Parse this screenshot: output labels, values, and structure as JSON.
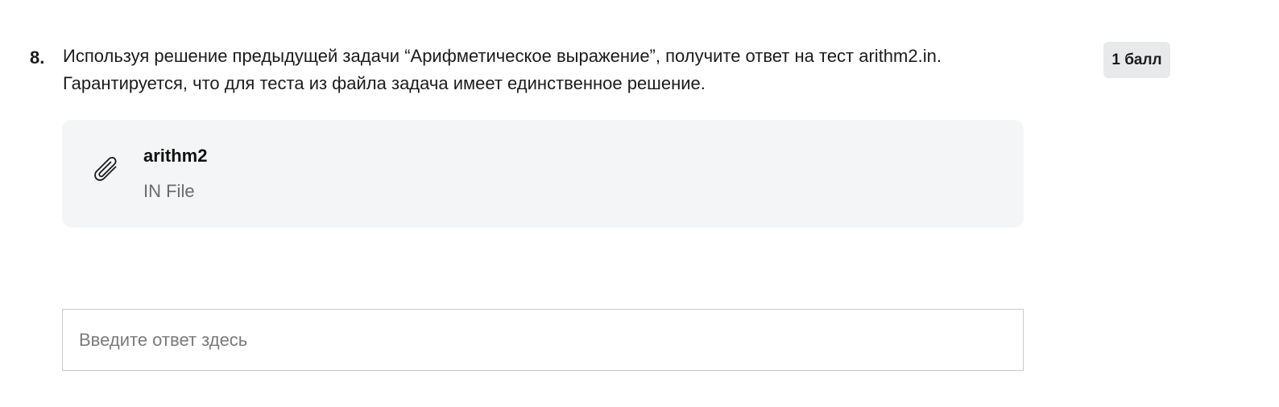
{
  "question": {
    "number": "8.",
    "text_line1": "Используя решение предыдущей задачи “Арифметическое выражение”, получите ответ на тест arithm2.in.",
    "text_line2": "Гарантируется, что для теста из файла задача имеет единственное решение.",
    "points": "1 балл"
  },
  "attachment": {
    "icon": "paperclip-icon",
    "name": "arithm2",
    "type": "IN File"
  },
  "answer": {
    "value": "",
    "placeholder": "Введите ответ здесь"
  }
}
